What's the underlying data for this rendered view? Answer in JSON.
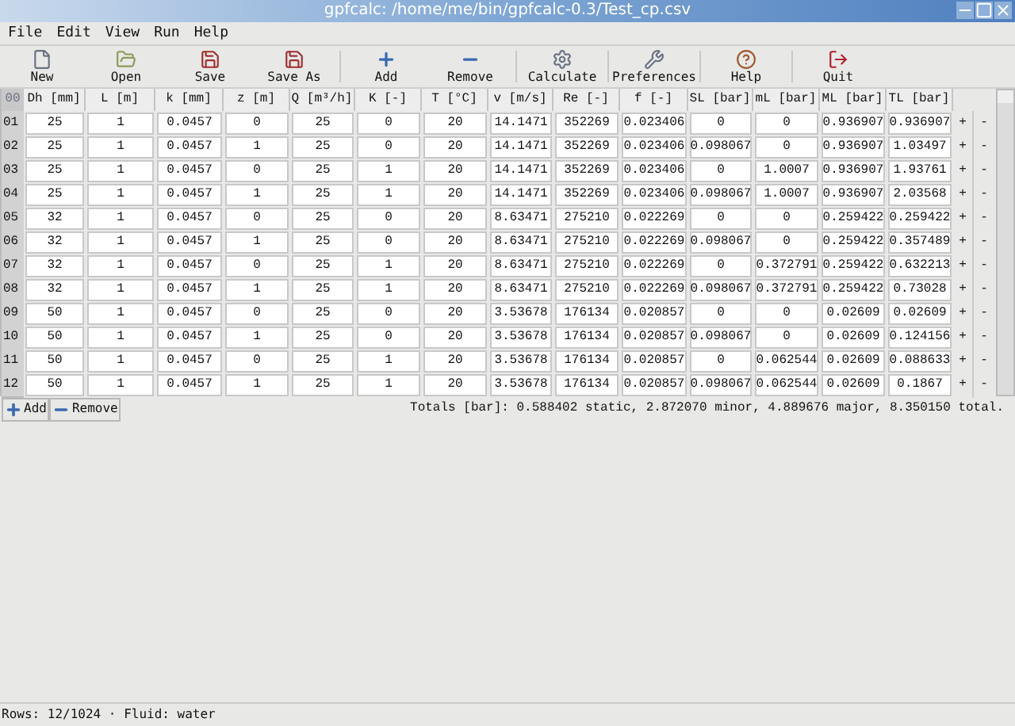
{
  "window": {
    "title": "gpfcalc: /home/me/bin/gpfcalc-0.3/Test_cp.csv"
  },
  "menu": [
    "File",
    "Edit",
    "View",
    "Run",
    "Help"
  ],
  "toolbar": [
    {
      "kind": "new",
      "label": "New"
    },
    {
      "kind": "open",
      "label": "Open"
    },
    {
      "kind": "save",
      "label": "Save"
    },
    {
      "kind": "saveas",
      "label": "Save As"
    },
    {
      "kind": "add",
      "label": "Add"
    },
    {
      "kind": "remove",
      "label": "Remove"
    },
    {
      "kind": "calculate",
      "label": "Calculate"
    },
    {
      "kind": "preferences",
      "label": "Preferences"
    },
    {
      "kind": "help",
      "label": "Help"
    },
    {
      "kind": "quit",
      "label": "Quit"
    }
  ],
  "table": {
    "corner": "00",
    "columns": [
      "Dh [mm]",
      "L [m]",
      "k [mm]",
      "z [m]",
      "Q [m³/h]",
      "K [-]",
      "T [°C]",
      "v [m/s]",
      "Re [-]",
      "f [-]",
      "SL [bar]",
      "mL [bar]",
      "ML [bar]",
      "TL [bar]"
    ],
    "rows": [
      {
        "index": "01",
        "cells": [
          "25",
          "1",
          "0.0457",
          "0",
          "25",
          "0",
          "20",
          "14.1471",
          "352269",
          "0.023406",
          "0",
          "0",
          "0.936907",
          "0.936907"
        ],
        "add": "+",
        "remove": "-"
      },
      {
        "index": "02",
        "cells": [
          "25",
          "1",
          "0.0457",
          "1",
          "25",
          "0",
          "20",
          "14.1471",
          "352269",
          "0.023406",
          "0.098067",
          "0",
          "0.936907",
          "1.03497"
        ],
        "add": "+",
        "remove": "-"
      },
      {
        "index": "03",
        "cells": [
          "25",
          "1",
          "0.0457",
          "0",
          "25",
          "1",
          "20",
          "14.1471",
          "352269",
          "0.023406",
          "0",
          "1.0007",
          "0.936907",
          "1.93761"
        ],
        "add": "+",
        "remove": "-"
      },
      {
        "index": "04",
        "cells": [
          "25",
          "1",
          "0.0457",
          "1",
          "25",
          "1",
          "20",
          "14.1471",
          "352269",
          "0.023406",
          "0.098067",
          "1.0007",
          "0.936907",
          "2.03568"
        ],
        "add": "+",
        "remove": "-"
      },
      {
        "index": "05",
        "cells": [
          "32",
          "1",
          "0.0457",
          "0",
          "25",
          "0",
          "20",
          "8.63471",
          "275210",
          "0.022269",
          "0",
          "0",
          "0.259422",
          "0.259422"
        ],
        "add": "+",
        "remove": "-"
      },
      {
        "index": "06",
        "cells": [
          "32",
          "1",
          "0.0457",
          "1",
          "25",
          "0",
          "20",
          "8.63471",
          "275210",
          "0.022269",
          "0.098067",
          "0",
          "0.259422",
          "0.357489"
        ],
        "add": "+",
        "remove": "-"
      },
      {
        "index": "07",
        "cells": [
          "32",
          "1",
          "0.0457",
          "0",
          "25",
          "1",
          "20",
          "8.63471",
          "275210",
          "0.022269",
          "0",
          "0.372791",
          "0.259422",
          "0.632213"
        ],
        "add": "+",
        "remove": "-"
      },
      {
        "index": "08",
        "cells": [
          "32",
          "1",
          "0.0457",
          "1",
          "25",
          "1",
          "20",
          "8.63471",
          "275210",
          "0.022269",
          "0.098067",
          "0.372791",
          "0.259422",
          "0.73028"
        ],
        "add": "+",
        "remove": "-"
      },
      {
        "index": "09",
        "cells": [
          "50",
          "1",
          "0.0457",
          "0",
          "25",
          "0",
          "20",
          "3.53678",
          "176134",
          "0.020857",
          "0",
          "0",
          "0.02609",
          "0.02609"
        ],
        "add": "+",
        "remove": "-"
      },
      {
        "index": "10",
        "cells": [
          "50",
          "1",
          "0.0457",
          "1",
          "25",
          "0",
          "20",
          "3.53678",
          "176134",
          "0.020857",
          "0.098067",
          "0",
          "0.02609",
          "0.124156"
        ],
        "add": "+",
        "remove": "-"
      },
      {
        "index": "11",
        "cells": [
          "50",
          "1",
          "0.0457",
          "0",
          "25",
          "1",
          "20",
          "3.53678",
          "176134",
          "0.020857",
          "0",
          "0.062544",
          "0.02609",
          "0.088633"
        ],
        "add": "+",
        "remove": "-"
      },
      {
        "index": "12",
        "cells": [
          "50",
          "1",
          "0.0457",
          "1",
          "25",
          "1",
          "20",
          "3.53678",
          "176134",
          "0.020857",
          "0.098067",
          "0.062544",
          "0.02609",
          "0.1867"
        ],
        "add": "+",
        "remove": "-"
      }
    ]
  },
  "actions": [
    {
      "kind": "add",
      "label": "Add"
    },
    {
      "kind": "remove",
      "label": "Remove"
    }
  ],
  "totals": "Totals [bar]: 0.588402 static, 2.872070 minor, 4.889676 major, 8.350150 total.",
  "status_bar": "Rows: 12/1024 · Fluid: water"
}
